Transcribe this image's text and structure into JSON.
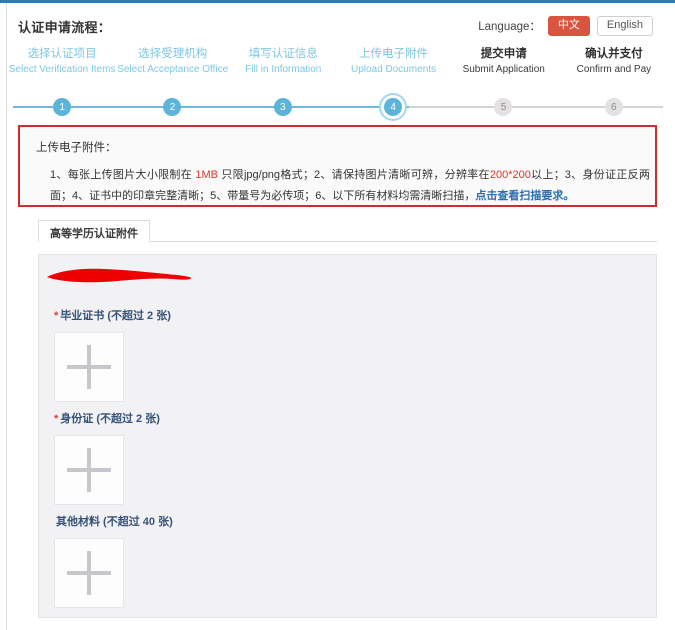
{
  "header": {
    "title": "认证申请流程：",
    "language_label": "Language：",
    "lang_cn": "中文",
    "lang_en": "English"
  },
  "stepper": {
    "steps": [
      {
        "num": "1",
        "cn": "选择认证项目",
        "en": "Select Verification Items",
        "state": "done"
      },
      {
        "num": "2",
        "cn": "选择受理机构",
        "en": "Select Acceptance Office",
        "state": "done"
      },
      {
        "num": "3",
        "cn": "填写认证信息",
        "en": "Fill in Information",
        "state": "done"
      },
      {
        "num": "4",
        "cn": "上传电子附件",
        "en": "Upload Documents",
        "state": "current"
      },
      {
        "num": "5",
        "cn": "提交申请",
        "en": "Submit Application",
        "state": "todo"
      },
      {
        "num": "6",
        "cn": "确认并支付",
        "en": "Confirm and Pay",
        "state": "todo"
      }
    ]
  },
  "notice": {
    "title": "上传电子附件：",
    "seg_1": "1、每张上传图片大小限制在 ",
    "seg_1mb": "1MB",
    "seg_2": " 只限jpg/png格式；2、请保持图片清晰可辨，分辨率在",
    "seg_res": "200*200",
    "seg_3": "以上；3、身份证正反两面；4、证书中的印章完整清晰；5、带量号为必传项；6、以下所有材料均需清晰扫描，",
    "link": "点击查看扫描要求。",
    "border_color": "#d32a2a"
  },
  "tab": {
    "label": "高等学历认证附件"
  },
  "uploads": {
    "groups": [
      {
        "required": true,
        "star": "*",
        "label": "毕业证书 (不超过 2 张)",
        "icon": "plus-icon"
      },
      {
        "required": true,
        "star": "*",
        "label": "身份证 (不超过 2 张)",
        "icon": "plus-icon"
      },
      {
        "required": false,
        "star": "",
        "label": "其他材料 (不超过 40 张)",
        "icon": "plus-icon"
      }
    ],
    "redaction_color": "#ee0000"
  },
  "colors": {
    "accent_blue": "#5cb4d8",
    "top_bar": "#2b7bb9",
    "lang_active": "#d9553f",
    "alert_red": "#d9342b",
    "link_blue": "#2b6fb0"
  }
}
